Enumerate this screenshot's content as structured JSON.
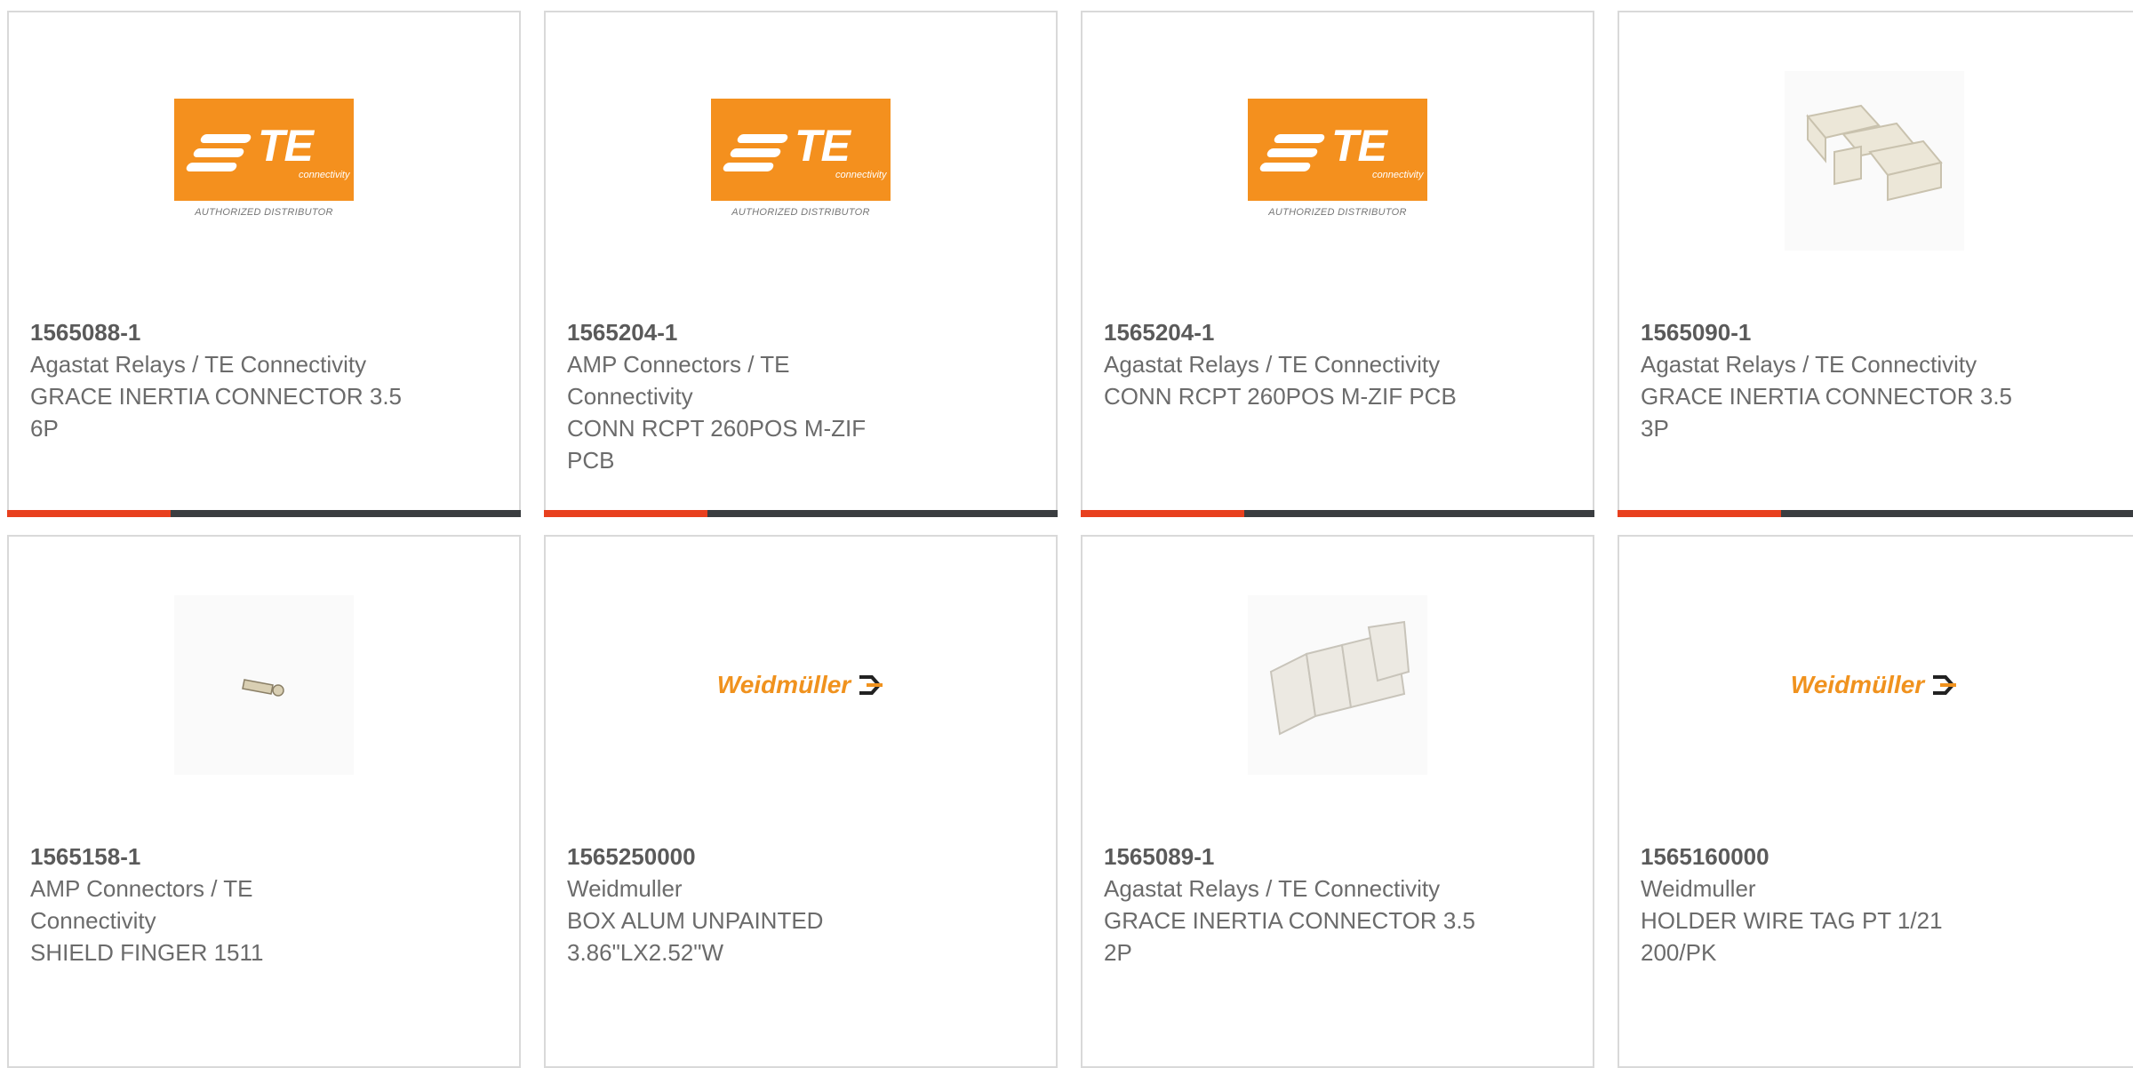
{
  "products": [
    {
      "part": "1565088-1",
      "brand": "Agastat Relays / TE Connectivity",
      "desc": "GRACE INERTIA CONNECTOR 3.5 6P",
      "image": "te-logo"
    },
    {
      "part": "1565204-1",
      "brand": "AMP Connectors / TE Connectivity",
      "desc": "CONN RCPT 260POS M-ZIF PCB",
      "image": "te-logo"
    },
    {
      "part": "1565204-1",
      "brand": "Agastat Relays / TE Connectivity",
      "desc": "CONN RCPT 260POS M-ZIF PCB",
      "image": "te-logo"
    },
    {
      "part": "1565090-1",
      "brand": "Agastat Relays / TE Connectivity",
      "desc": "GRACE INERTIA CONNECTOR 3.5 3P",
      "image": "connector-photo"
    },
    {
      "part": "1565158-1",
      "brand": "AMP Connectors / TE Connectivity",
      "desc": "SHIELD FINGER 1511",
      "image": "shield-finger-photo"
    },
    {
      "part": "1565250000",
      "brand": "Weidmuller",
      "desc": "BOX ALUM UNPAINTED 3.86\"LX2.52\"W",
      "image": "weidmuller-logo"
    },
    {
      "part": "1565089-1",
      "brand": "Agastat Relays / TE Connectivity",
      "desc": "GRACE INERTIA CONNECTOR 3.5 2P",
      "image": "connector-photo"
    },
    {
      "part": "1565160000",
      "brand": "Weidmuller",
      "desc": "HOLDER WIRE TAG PT 1/21 200/PK",
      "image": "weidmuller-logo"
    }
  ],
  "logos": {
    "te_text": "TE",
    "te_sub": "connectivity",
    "te_auth": "AUTHORIZED DISTRIBUTOR",
    "weidmuller": "Weidmüller"
  },
  "colors": {
    "te_orange": "#f4901e",
    "accent_bar": "#e8401e",
    "dark_bar": "#3a3d40",
    "weidmuller_orange": "#f0921e"
  }
}
